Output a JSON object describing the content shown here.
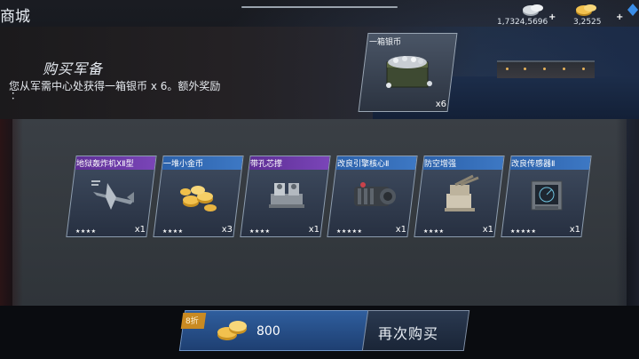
{
  "header": {
    "title": "商城",
    "currencies": [
      {
        "name": "silver",
        "icon": "silver-coin-icon",
        "value": "1,7324,5696"
      },
      {
        "name": "gold",
        "icon": "gold-coin-icon",
        "value": "3,2525"
      }
    ]
  },
  "banner": {
    "title": "购买军备",
    "description": "您从军需中心处获得一箱银币 x 6。额外奖励",
    "continuation": "：",
    "reward": {
      "name": "一箱银币",
      "quantity": "x6",
      "icon": "silver-chest-icon"
    }
  },
  "items": [
    {
      "name": "地狱轰炸机ⅩⅡ型",
      "quantity": "x1",
      "stars": 4,
      "rarity": "purple",
      "icon": "bomber-plane-icon"
    },
    {
      "name": "一堆小金币",
      "quantity": "x3",
      "stars": 4,
      "rarity": "blue",
      "icon": "gold-coins-icon"
    },
    {
      "name": "带孔芯撑",
      "quantity": "x1",
      "stars": 4,
      "rarity": "purple",
      "icon": "chaplet-part-icon"
    },
    {
      "name": "改良引擎核心Ⅱ",
      "quantity": "x1",
      "stars": 5,
      "rarity": "blue",
      "icon": "engine-core-icon"
    },
    {
      "name": "防空增强",
      "quantity": "x1",
      "stars": 4,
      "rarity": "blue",
      "icon": "anti-air-gun-icon"
    },
    {
      "name": "改良传感器Ⅱ",
      "quantity": "x1",
      "stars": 5,
      "rarity": "blue",
      "icon": "radar-sensor-icon"
    }
  ],
  "purchase": {
    "discount_label": "8折",
    "price": "800",
    "price_icon": "gold-coin-icon",
    "buy_again_label": "再次购买"
  },
  "colors": {
    "blue_rarity": "#3d78c4",
    "purple_rarity": "#7a45b8",
    "price_box": "#2f5e9e",
    "discount_tag": "#c98a22"
  }
}
